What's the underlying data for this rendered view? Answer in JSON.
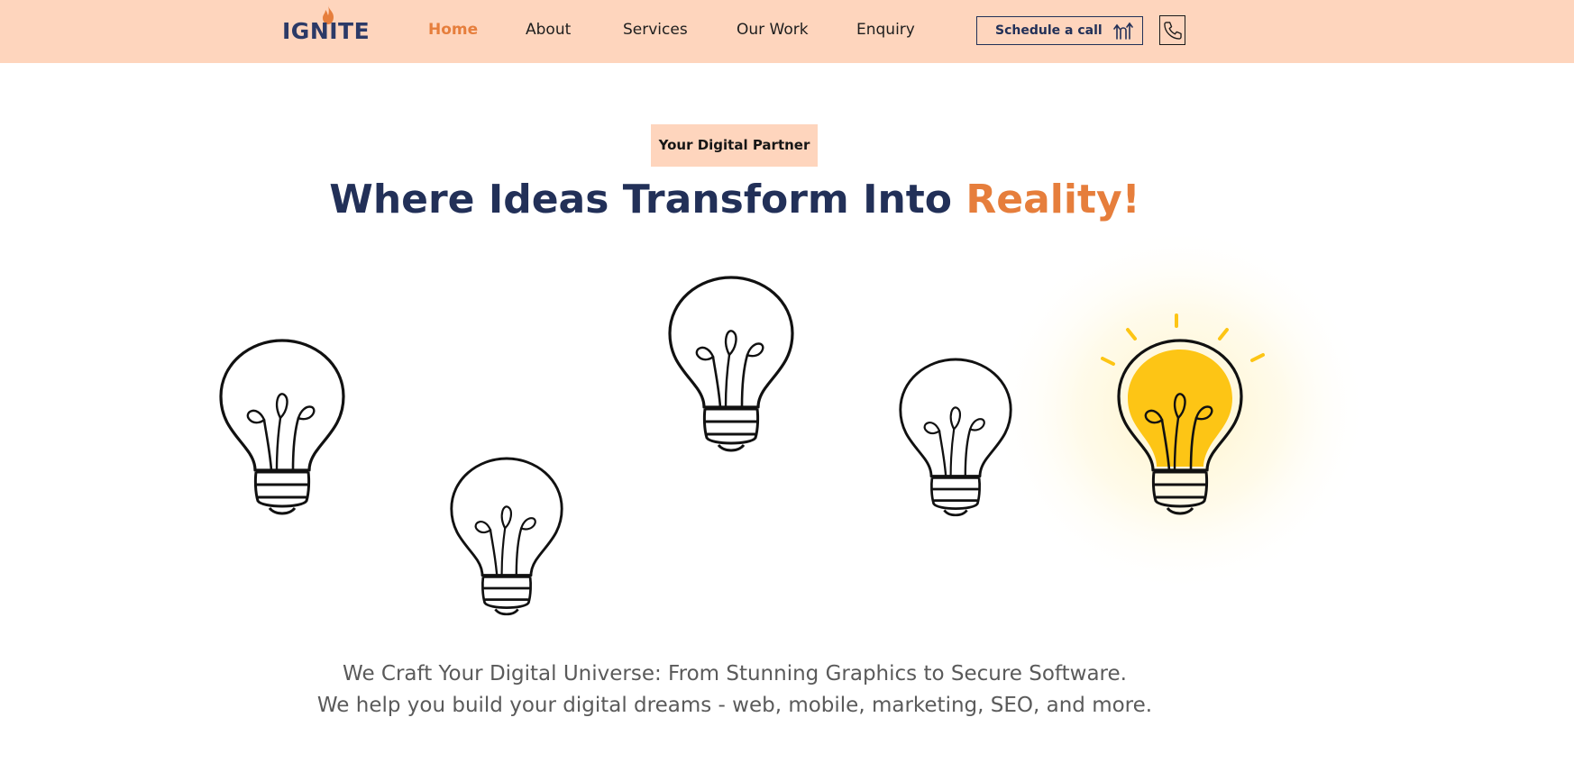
{
  "header": {
    "logo_text": "IGNITE",
    "nav": [
      {
        "label": "Home",
        "active": true
      },
      {
        "label": "About",
        "active": false
      },
      {
        "label": "Services",
        "active": false
      },
      {
        "label": "Our Work",
        "active": false
      },
      {
        "label": "Enquiry",
        "active": false
      }
    ],
    "schedule_label": "Schedule a call",
    "schedule_icon": "arrows-up-icon",
    "phone_icon": "phone-icon"
  },
  "hero": {
    "badge": "Your Digital Partner",
    "headline_main": "Where Ideas Transform Into ",
    "headline_accent": "Reality!",
    "tagline_line1": "We Craft Your Digital Universe: From Stunning Graphics to Secure Software.",
    "tagline_line2": "We help you build your digital dreams - web, mobile, marketing, SEO, and more."
  },
  "colors": {
    "header_bg": "#fed5bd",
    "navy": "#223058",
    "accent": "#e67e3c",
    "bulb_lit": "#fdc515"
  }
}
